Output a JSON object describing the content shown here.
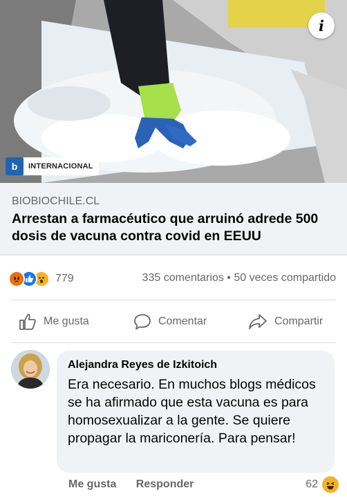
{
  "post": {
    "badge_logo": "b",
    "badge_label": "INTERNACIONAL",
    "info_icon": "i",
    "domain": "BIOBIOCHILE.CL",
    "headline": "Arrestan a farmacéutico que arruinó adrede 500 dosis de vacuna contra covid en EEUU"
  },
  "reactions": {
    "icons": [
      "angry-reaction-icon",
      "like-reaction-icon",
      "wow-reaction-icon"
    ],
    "count": "779",
    "comments": "335 comentarios",
    "separator": "•",
    "shares": "50 veces compartido"
  },
  "actions": {
    "like": "Me gusta",
    "comment": "Comentar",
    "share": "Compartir"
  },
  "comment": {
    "author": "Alejandra Reyes de Izkitoich",
    "text": "Era necesario. En muchos blogs médicos se ha afirmado que esta vacuna es para homosexualizar a la gente. Se quiere propagar la mariconería. Para pensar!",
    "like": "Me gusta",
    "reply": "Responder",
    "reaction_count": "62",
    "reaction_icon": "haha-reaction-icon"
  },
  "colors": {
    "facebook_blue": "#1877f2",
    "secondary_text": "#65676b",
    "bubble_bg": "#f0f2f5",
    "badge_blue": "#1f63b1",
    "glove_green": "#a6e04a",
    "glove_blue": "#2a62b8"
  }
}
